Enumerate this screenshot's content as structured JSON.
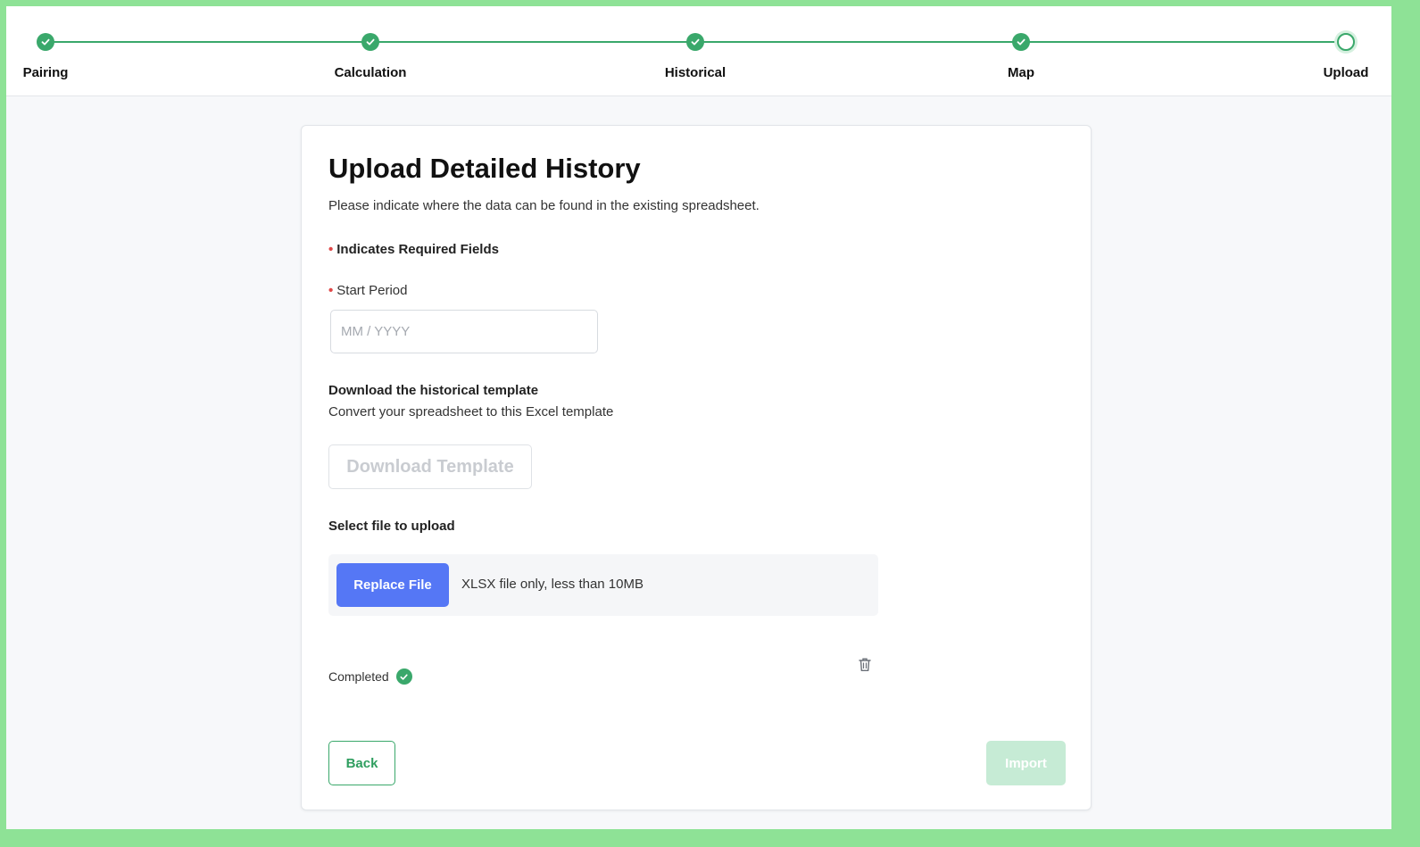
{
  "stepper": {
    "steps": [
      {
        "label": "Pairing",
        "status": "complete"
      },
      {
        "label": "Calculation",
        "status": "complete"
      },
      {
        "label": "Historical",
        "status": "complete"
      },
      {
        "label": "Map",
        "status": "complete"
      },
      {
        "label": "Upload",
        "status": "current"
      }
    ]
  },
  "page": {
    "title": "Upload Detailed History",
    "subtitle": "Please indicate where the data can be found in the existing spreadsheet.",
    "required_note": "Indicates Required Fields"
  },
  "start_period": {
    "label": "Start Period",
    "placeholder": "MM / YYYY",
    "value": ""
  },
  "template": {
    "title": "Download the historical template",
    "description": "Convert your spreadsheet to this Excel template",
    "button_label": "Download Template"
  },
  "upload": {
    "title": "Select file to upload",
    "button_label": "Replace File",
    "hint": "XLSX file only, less than 10MB",
    "status": "Completed"
  },
  "actions": {
    "back_label": "Back",
    "import_label": "Import"
  },
  "colors": {
    "accent": "#3aa86b",
    "primary_button": "#5577f5",
    "required": "#e04848",
    "disabled_import": "#c6ebd5"
  },
  "icons": {
    "step_complete": "check-icon",
    "status_complete": "check-circle-icon",
    "delete": "trash-icon"
  }
}
